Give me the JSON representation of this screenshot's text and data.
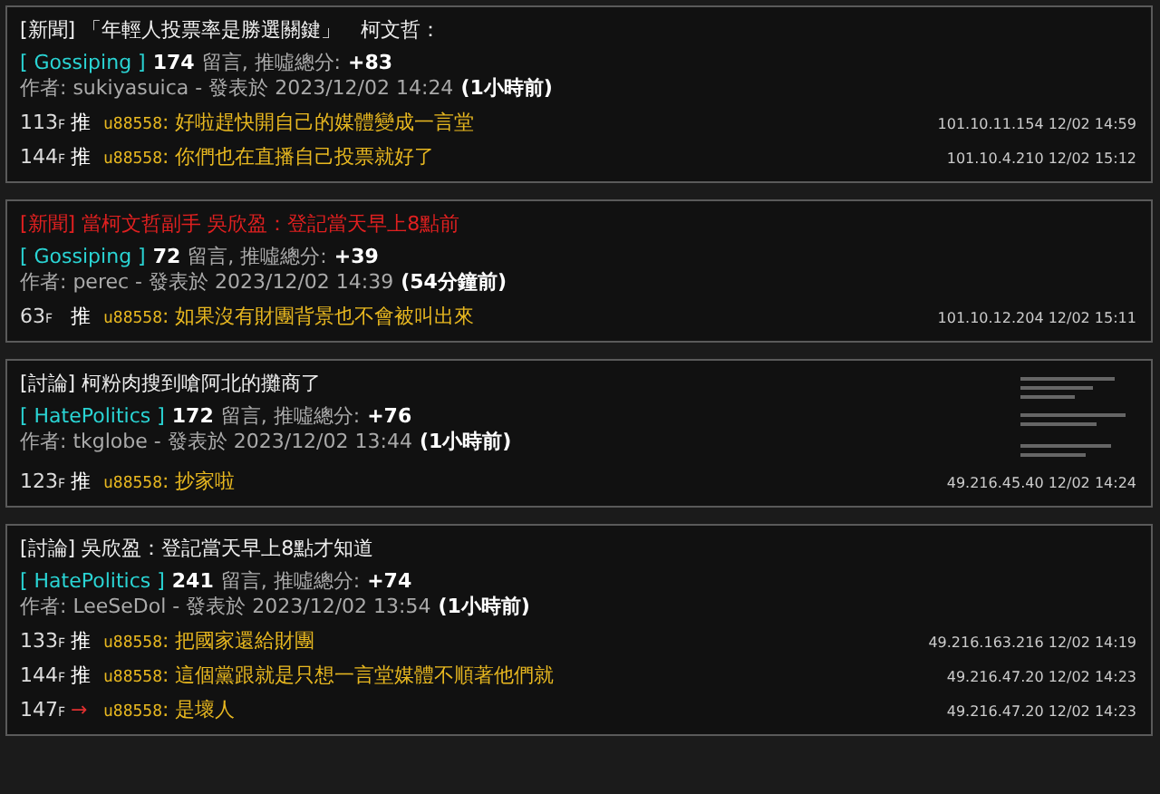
{
  "posts": [
    {
      "title": "[新聞] 「年輕人投票率是勝選關鍵」　柯文哲：",
      "highlighted": false,
      "board": "[ Gossiping ]",
      "comments_count": "174",
      "comments_label": "留言, 推噓總分:",
      "score": "+83",
      "author_line": "作者: sukiyasuica - 發表於 2023/12/02 14:24",
      "age": "(1小時前)",
      "has_thumbnail": false,
      "comments": [
        {
          "floor": "113$_{F}$",
          "kind": "push",
          "tag": "推",
          "user": "u88558",
          "text": ": 好啦趕快開自己的媒體變成一言堂",
          "meta": "101.10.11.154 12/02 14:59"
        },
        {
          "floor": "144$_{F}$",
          "kind": "push",
          "tag": "推",
          "user": "u88558",
          "text": ": 你們也在直播自己投票就好了",
          "meta": "101.10.4.210 12/02 15:12"
        }
      ]
    },
    {
      "title": "[新聞] 當柯文哲副手 吳欣盈：登記當天早上8點前",
      "highlighted": true,
      "board": "[ Gossiping ]",
      "comments_count": "72",
      "comments_label": "留言, 推噓總分:",
      "score": "+39",
      "author_line": "作者: perec - 發表於 2023/12/02 14:39",
      "age": "(54分鐘前)",
      "has_thumbnail": false,
      "comments": [
        {
          "floor": "63$_{F}$",
          "kind": "push",
          "tag": "推",
          "user": "u88558",
          "text": ": 如果沒有財團背景也不會被叫出來",
          "meta": "101.10.12.204 12/02 15:11"
        }
      ]
    },
    {
      "title": "[討論] 柯粉肉搜到嗆阿北的攤商了",
      "highlighted": false,
      "board": "[ HatePolitics ]",
      "comments_count": "172",
      "comments_label": "留言, 推噓總分:",
      "score": "+76",
      "author_line": "作者: tkglobe - 發表於 2023/12/02 13:44",
      "age": "(1小時前)",
      "has_thumbnail": true,
      "comments": [
        {
          "floor": "123$_{F}$",
          "kind": "push",
          "tag": "推",
          "user": "u88558",
          "text": ": 抄家啦",
          "meta": "49.216.45.40 12/02 14:24"
        }
      ]
    },
    {
      "title": "[討論] 吳欣盈：登記當天早上8點才知道",
      "highlighted": false,
      "board": "[ HatePolitics ]",
      "comments_count": "241",
      "comments_label": "留言, 推噓總分:",
      "score": "+74",
      "author_line": "作者: LeeSeDol - 發表於 2023/12/02 13:54",
      "age": "(1小時前)",
      "has_thumbnail": false,
      "comments": [
        {
          "floor": "133$_{F}$",
          "kind": "push",
          "tag": "推",
          "user": "u88558",
          "text": ": 把國家還給財團",
          "meta": "49.216.163.216 12/02 14:19"
        },
        {
          "floor": "144$_{F}$",
          "kind": "push",
          "tag": "推",
          "user": "u88558",
          "text": ": 這個黨跟就是只想一言堂媒體不順著他們就",
          "meta": "49.216.47.20 12/02 14:23"
        },
        {
          "floor": "147$_{F}$",
          "kind": "arrow",
          "tag": "→",
          "user": "u88558",
          "text": ": 是壞人",
          "meta": "49.216.47.20 12/02 14:23"
        }
      ]
    }
  ]
}
